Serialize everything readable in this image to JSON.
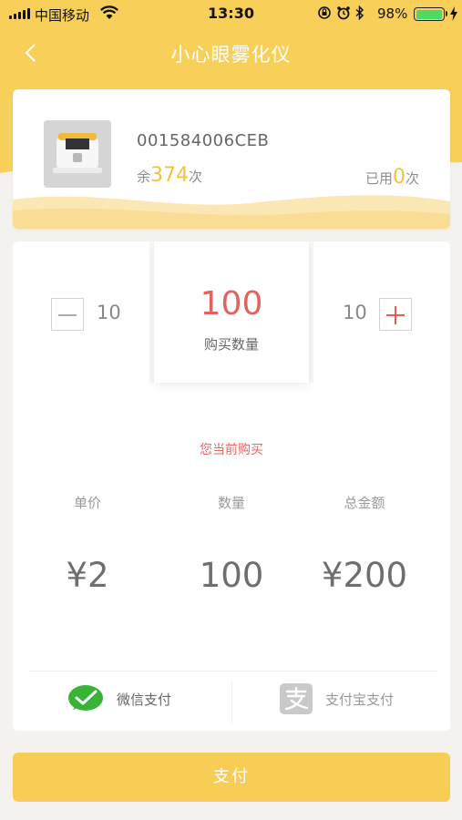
{
  "status_bar": {
    "carrier": "中国移动",
    "time": "13:30",
    "battery": "98%",
    "battery_level": 0.98
  },
  "nav": {
    "title": "小心眼雾化仪"
  },
  "device": {
    "serial": "001584006CEB",
    "remain_prefix": "余",
    "remain_count": "374",
    "remain_suffix": "次",
    "used_prefix": "已用",
    "used_count": "0",
    "used_suffix": "次"
  },
  "quantity": {
    "decrement_step": "10",
    "increment_step": "10",
    "value": "100",
    "label": "购买数量"
  },
  "summary": {
    "heading": "您当前购买",
    "columns": [
      {
        "label": "单价",
        "value": "¥2"
      },
      {
        "label": "数量",
        "value": "100"
      },
      {
        "label": "总金额",
        "value": "¥200"
      }
    ]
  },
  "payment": {
    "wechat_label": "微信支付",
    "alipay_label": "支付宝支付",
    "pay_button": "支付"
  },
  "colors": {
    "accent_yellow": "#f8cf58",
    "highlight_red": "#e0635e",
    "wechat_green": "#39b337"
  }
}
